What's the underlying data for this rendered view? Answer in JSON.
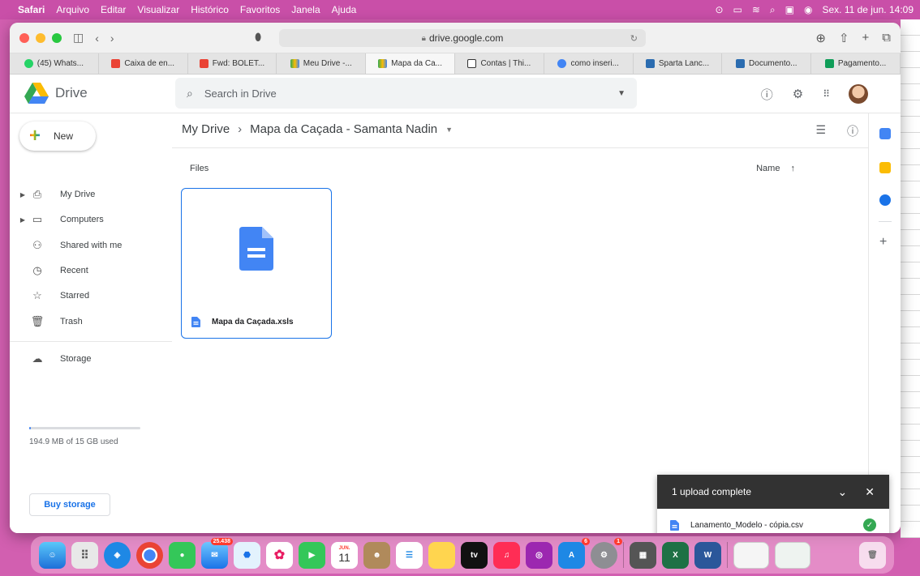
{
  "menubar": {
    "items": [
      "Safari",
      "Arquivo",
      "Editar",
      "Visualizar",
      "Histórico",
      "Favoritos",
      "Janela",
      "Ajuda"
    ],
    "clock": "Sex. 11 de jun.  14:09"
  },
  "browser": {
    "address": "drive.google.com",
    "tabs": [
      "(45) Whats...",
      "Caixa de en...",
      "Fwd: BOLET...",
      "Meu Drive -...",
      "Mapa da Ca...",
      "Contas | Thi...",
      "como inseri...",
      "Sparta Lanc...",
      "Documento...",
      "Pagamento..."
    ]
  },
  "drive": {
    "logo_text": "Drive",
    "search_placeholder": "Search in Drive",
    "new_label": "New",
    "nav": {
      "my_drive": "My Drive",
      "computers": "Computers",
      "shared": "Shared with me",
      "recent": "Recent",
      "starred": "Starred",
      "trash": "Trash",
      "storage": "Storage"
    },
    "storage_used": "194.9 MB of 15 GB used",
    "storage_fraction": 0.013,
    "buy_storage": "Buy storage",
    "breadcrumb_root": "My Drive",
    "breadcrumb_folder": "Mapa da Caçada - Samanta Nadin",
    "files_label": "Files",
    "sort_label": "Name",
    "file_name": "Mapa da Caçada.xsls"
  },
  "toast": {
    "title": "1 upload complete",
    "file_name": "Lanamento_Modelo - cópia.csv"
  },
  "dock": {
    "mail_badge": "25.438",
    "calendar_month": "JUN.",
    "calendar_day": "11",
    "appstore_badge": "6",
    "settings_badge": "1",
    "tv_label": "tv"
  },
  "colors": {
    "accent": "#1a73e8",
    "doc_blue": "#4285f4",
    "success": "#34a853"
  }
}
